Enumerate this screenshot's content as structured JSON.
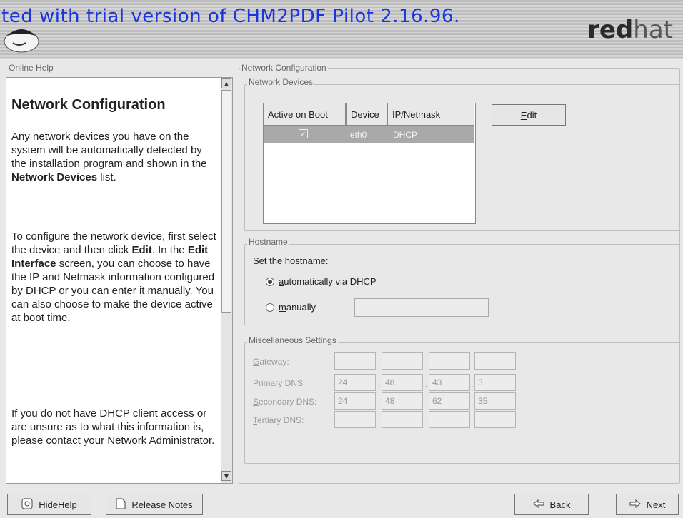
{
  "header": {
    "watermark": "ted with trial version of CHM2PDF Pilot 2.16.96.",
    "brand_bold": "red",
    "brand_light": "hat"
  },
  "help": {
    "frame_title": "Online Help",
    "heading": "Network Configuration",
    "p1": [
      "Any network devices you have on the system will be automatically detected by the installation program and shown in the ",
      "Network Devices",
      " list."
    ],
    "p2": [
      "To configure the network device, first select the device and then click ",
      "Edit",
      ". In the ",
      "Edit Interface",
      " screen, you can choose to have the IP and Netmask information configured by DHCP or you can enter it manually. You can also choose to make the device active at boot time."
    ],
    "p3": "If you do not have DHCP client access or are unsure as to what this information is, please contact your Network Administrator."
  },
  "network_config": {
    "frame_title": "Network Configuration",
    "devices": {
      "frame_title": "Network Devices",
      "columns": [
        "Active on Boot",
        "Device",
        "IP/Netmask"
      ],
      "rows": [
        {
          "active": true,
          "device": "eth0",
          "ip": "DHCP"
        }
      ],
      "edit_label_u": "E",
      "edit_label_rest": "dit"
    },
    "hostname": {
      "frame_title": "Hostname",
      "prompt": "Set the hostname:",
      "auto_u": "a",
      "auto_rest": "utomatically via DHCP",
      "manual_u": "m",
      "manual_rest": "anually",
      "manual_value": "",
      "selected": "automatically"
    },
    "misc": {
      "frame_title": "Miscellaneous Settings",
      "rows": [
        {
          "u": "G",
          "rest": "ateway:",
          "octets": [
            "",
            "",
            "",
            ""
          ]
        },
        {
          "u": "P",
          "rest": "rimary DNS:",
          "octets": [
            "24",
            "48",
            "43",
            "3"
          ]
        },
        {
          "u": "S",
          "rest": "econdary DNS:",
          "octets": [
            "24",
            "48",
            "62",
            "35"
          ]
        },
        {
          "u": "T",
          "rest": "ertiary DNS:",
          "octets": [
            "",
            "",
            "",
            ""
          ]
        }
      ]
    }
  },
  "bottom": {
    "hide_help_pre": "Hide ",
    "hide_help_u": "H",
    "hide_help_rest": "elp",
    "release_u": "R",
    "release_rest": "elease Notes",
    "back_u": "B",
    "back_rest": "ack",
    "next_u": "N",
    "next_rest": "ext"
  }
}
